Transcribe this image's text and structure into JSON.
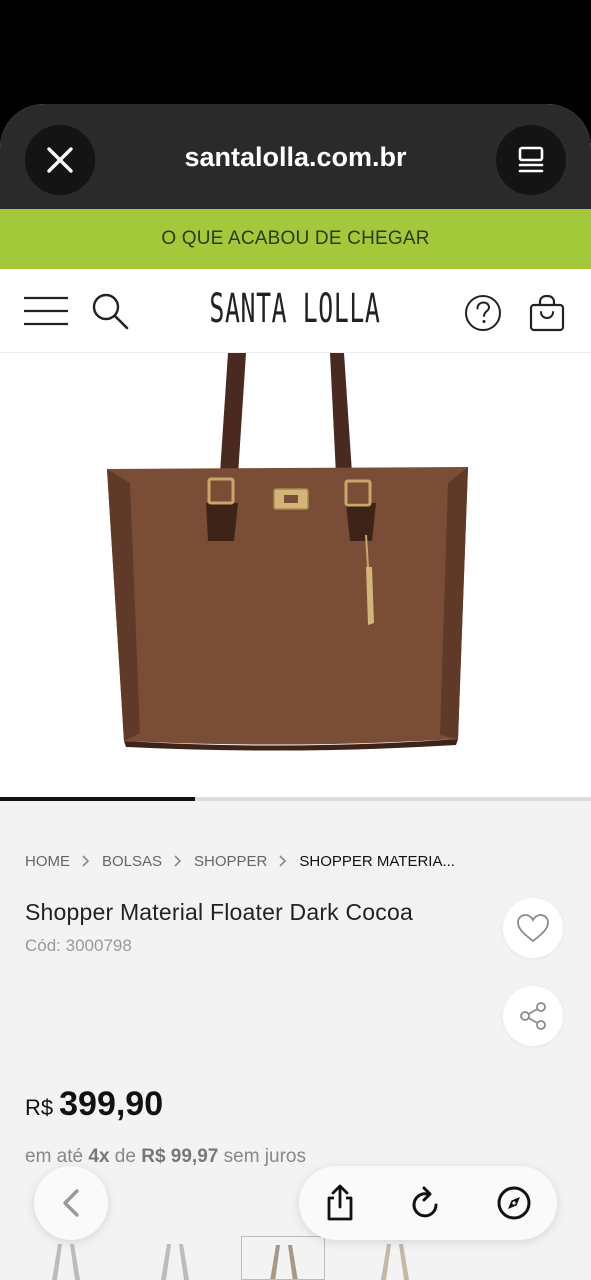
{
  "browser": {
    "url": "santalolla.com.br",
    "close_icon": "close-icon",
    "tabs_icon": "tabs-icon"
  },
  "promo": {
    "text": "O QUE ACABOU DE CHEGAR",
    "color": "#a3c83a"
  },
  "header": {
    "logo_text": "SANTA LOLLA",
    "menu_icon": "hamburger-menu-icon",
    "search_icon": "search-icon",
    "help_icon": "help-icon",
    "bag_icon": "shopping-bag-icon"
  },
  "gallery": {
    "product_image": "brown leather shopper bag",
    "progress": 0.33
  },
  "breadcrumb": [
    "HOME",
    "BOLSAS",
    "SHOPPER",
    "SHOPPER MATERIA..."
  ],
  "product": {
    "name": "Shopper Material Floater Dark Cocoa",
    "code": "Cód: 3000798",
    "currency": "R$",
    "price": "399,90",
    "installment": {
      "prefix": "em até",
      "count": "4x",
      "mid": "de",
      "amount": "R$ 99,97",
      "suffix": "sem juros"
    }
  },
  "actions": {
    "favorite_icon": "heart-icon",
    "share_icon": "share-icon"
  },
  "toolbar": {
    "back_icon": "chevron-left-icon",
    "share_icon": "share-icon",
    "reload_icon": "reload-icon",
    "compass_icon": "compass-icon"
  }
}
